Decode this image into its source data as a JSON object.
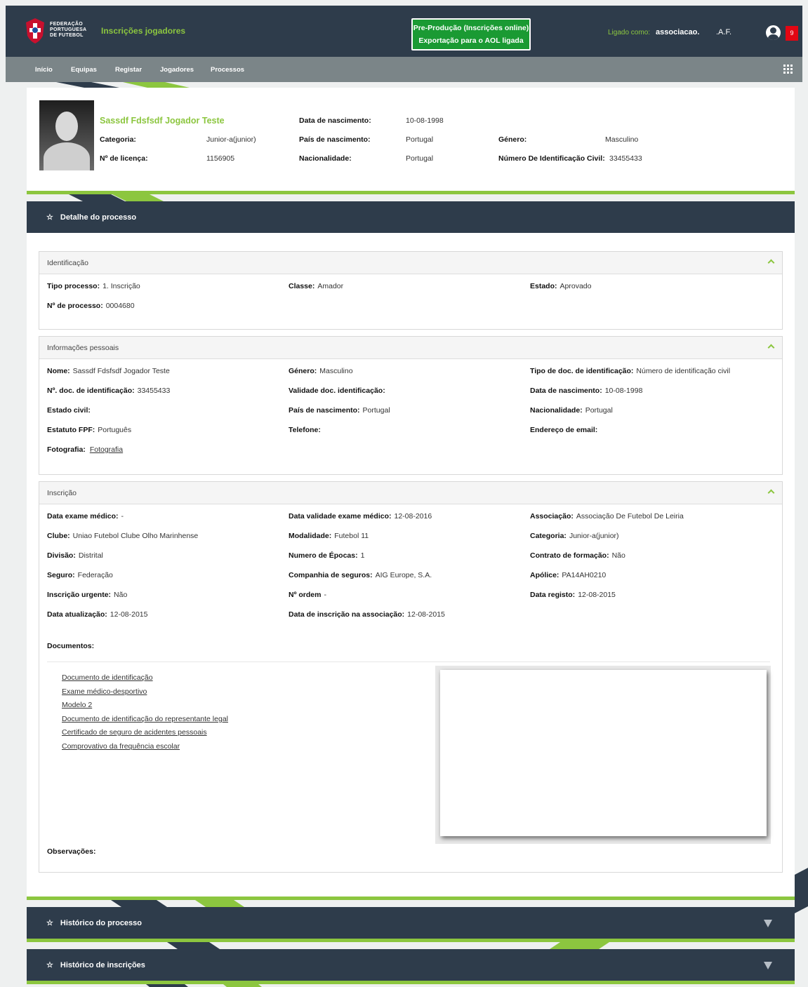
{
  "header": {
    "logo_text": [
      "FEDERAÇÃO",
      "PORTUGUESA",
      "DE FUTEBOL"
    ],
    "app_title": "Inscrições jogadores",
    "env_line1": "Pre-Produção (Inscrições online)",
    "env_line2": "Exportação para o AOL ligada",
    "login_label": "Ligado como:",
    "login_user": "associacao.",
    "login_assoc": ".A.F.",
    "notification_count": "9"
  },
  "nav": {
    "items": [
      "Início",
      "Equipas",
      "Registar",
      "Jogadores",
      "Processos"
    ]
  },
  "player": {
    "name": "Sassdf Fdsfsdf Jogador Teste",
    "categoria_label": "Categoria:",
    "categoria": "Junior-a(junior)",
    "licenca_label": "Nº de licença:",
    "licenca": "1156905",
    "nascimento_label": "Data de nascimento:",
    "nascimento": "10-08-1998",
    "pais_label": "País de nascimento:",
    "pais": "Portugal",
    "nacionalidade_label": "Nacionalidade:",
    "nacionalidade": "Portugal",
    "genero_label": "Género:",
    "genero": "Masculino",
    "nic_label": "Número De Identificação Civil:",
    "nic": "33455433"
  },
  "detalhe": {
    "title": "Detalhe do processo",
    "identificacao": {
      "title": "Identificação",
      "tipo_label": "Tipo processo:",
      "tipo": "1. Inscrição",
      "classe_label": "Classe:",
      "classe": "Amador",
      "estado_label": "Estado:",
      "estado": "Aprovado",
      "num_label": "Nº de processo:",
      "num": "0004680"
    },
    "pessoais": {
      "title": "Informações pessoais",
      "nome_label": "Nome:",
      "nome": "Sassdf Fdsfsdf Jogador Teste",
      "genero_label": "Género:",
      "genero": "Masculino",
      "tipodoc_label": "Tipo de doc. de identificação:",
      "tipodoc": "Número de identificação civil",
      "ndoc_label": "Nº. doc. de identificação:",
      "ndoc": "33455433",
      "validade_label": "Validade doc. identificação:",
      "nascimento_label": "Data de nascimento:",
      "nascimento": "10-08-1998",
      "civil_label": "Estado civil:",
      "pais_label": "País de nascimento:",
      "pais": "Portugal",
      "nacionalidade_label": "Nacionalidade:",
      "nacionalidade": "Portugal",
      "estatuto_label": "Estatuto FPF:",
      "estatuto": "Português",
      "telefone_label": "Telefone:",
      "email_label": "Endereço de email:",
      "foto_label": "Fotografia:",
      "foto_link": "Fotografia"
    },
    "inscricao": {
      "title": "Inscrição",
      "exame_label": "Data exame médico:",
      "exame": "-",
      "validade_exame_label": "Data validade exame médico:",
      "validade_exame": "12-08-2016",
      "associacao_label": "Associação:",
      "associacao": "Associação De Futebol De Leiria",
      "clube_label": "Clube:",
      "clube": "Uniao Futebol Clube Olho Marinhense",
      "modalidade_label": "Modalidade:",
      "modalidade": "Futebol 11",
      "categoria_label": "Categoria:",
      "categoria": "Junior-a(junior)",
      "divisao_label": "Divisão:",
      "divisao": "Distrital",
      "epocas_label": "Numero de Épocas:",
      "epocas": "1",
      "contrato_label": "Contrato de formação:",
      "contrato": "Não",
      "seguro_label": "Seguro:",
      "seguro": "Federação",
      "companhia_label": "Companhia de seguros:",
      "companhia": "AIG Europe, S.A.",
      "apolice_label": "Apólice:",
      "apolice": "PA14AH0210",
      "urgente_label": "Inscrição urgente:",
      "urgente": "Não",
      "ordem_label": "Nº ordem",
      "ordem": "-",
      "registo_label": "Data registo:",
      "registo": "12-08-2015",
      "atualizacao_label": "Data atualização:",
      "atualizacao": "12-08-2015",
      "insc_assoc_label": "Data de inscrição na associação:",
      "insc_assoc": "12-08-2015",
      "documentos_label": "Documentos:",
      "documentos": [
        "Documento de identificação",
        "Exame médico-desportivo",
        "Modelo 2",
        "Documento de identificação do representante legal",
        "Certificado de seguro de acidentes pessoais",
        "Comprovativo da frequência escolar"
      ],
      "observacoes_label": "Observações:"
    }
  },
  "historico_processo": "Histórico do processo",
  "historico_inscricoes": "Histórico de inscrições",
  "colors": {
    "accent": "#8cc63f",
    "dark": "#2e3c4b",
    "nav": "#7b8588",
    "badge": "#1a9a33",
    "notif": "#e30613"
  }
}
